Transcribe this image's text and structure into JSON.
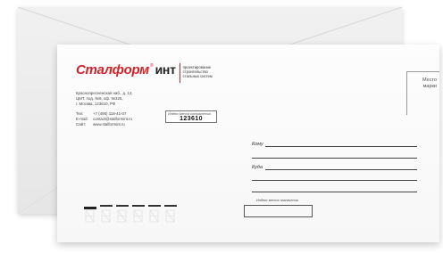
{
  "sender": {
    "brand": "Сталформ",
    "registered": "®",
    "unit": "инт",
    "tagline": [
      "проектирование",
      "строительство",
      "стальных систем"
    ],
    "address_lines": [
      "Краснопресненская наб., д. 12,",
      "ЦМТ, под. №6, оф. №325,",
      "г. Москва, 123610, РФ"
    ],
    "contacts": [
      {
        "label": "Тел:",
        "value": "+7 (495) 118-41-07"
      },
      {
        "label": "E-mail:",
        "value": "contact@stalformint.ru"
      },
      {
        "label": "Сайт:",
        "value": "www.stalformint.ru"
      }
    ],
    "index_label": "Индекс места отправления",
    "index_value": "123610"
  },
  "recipient": {
    "to_label": "Кому",
    "where_label": "Куда",
    "index_label": "Индекс места назначения"
  },
  "stamp": {
    "lines": [
      "Место",
      "марки"
    ]
  },
  "colors": {
    "brand_red": "#d2232a"
  }
}
